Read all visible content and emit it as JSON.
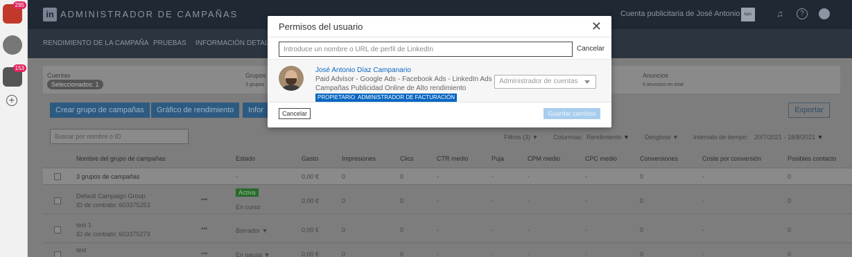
{
  "rail": {
    "apps": [
      {
        "name": "app-1",
        "badge": "295"
      },
      {
        "name": "app-2",
        "badge": ""
      },
      {
        "name": "app-3",
        "badge": "153"
      }
    ],
    "add_icon": "plus-icon"
  },
  "header": {
    "logo": "in",
    "title": "ADMINISTRADOR DE CAMPAÑAS",
    "account": "Cuenta publicitaria de José Antonio",
    "account_logo": "kpis",
    "icons": [
      "bell-icon",
      "help-icon",
      "globe-icon"
    ]
  },
  "subnav": {
    "items": [
      "RENDIMIENTO DE LA CAMPAÑA",
      "PRUEBAS",
      "INFORMACIÓN DETALLA"
    ]
  },
  "cards": {
    "accounts_title": "Cuentas",
    "accounts_chip": "Seleccionados: 1",
    "groups_title": "Grupos",
    "groups_sub": "3 grupos",
    "ads_title": "Anuncios",
    "ads_sub": "0 anuncios en total"
  },
  "actions": {
    "create": "Crear grupo de campañas",
    "chart": "Gráfico de rendimiento",
    "info": "Infor",
    "export": "Exportar"
  },
  "table_search": {
    "placeholder": "Buscar por nombre o ID"
  },
  "filters": {
    "filters": "Filtros (3)",
    "columns": "Columnas:",
    "columns_value": "Rendimiento",
    "breakdown": "Desglose",
    "time_label": "Intervalo de tiempo:",
    "time_value": "20/7/2021 - 18/8/2021"
  },
  "table": {
    "columns": [
      "Nombre del grupo de campañas",
      "Estado",
      "Gasto",
      "Impresiones",
      "Clics",
      "CTR medio",
      "Puja",
      "CPM medio",
      "CPC medio",
      "Conversiones",
      "Coste por conversión",
      "Posibles contacto"
    ],
    "summary": {
      "name": "3 grupos de campañas",
      "estado": "-",
      "gasto": "0,00 €",
      "impresiones": "0",
      "clics": "0",
      "ctr": "-",
      "puja": "-",
      "cpm": "-",
      "cpc": "-",
      "conv": "0",
      "coste": "-",
      "posibles": "0"
    },
    "rows": [
      {
        "name": "Default Campaign Group",
        "id": "ID de contrato: 603375253",
        "more": "•••",
        "status_badge": "Activa",
        "status": "En curso",
        "gasto": "0,00 €",
        "impresiones": "0",
        "clics": "0",
        "ctr": "-",
        "puja": "-",
        "cpm": "-",
        "cpc": "-",
        "conv": "0",
        "coste": "-",
        "posibles": "0"
      },
      {
        "name": "test 1",
        "id": "ID de contrato: 603375273",
        "more": "•••",
        "status": "Borrador ▼",
        "gasto": "0,00 €",
        "impresiones": "0",
        "clics": "0",
        "ctr": "-",
        "puja": "-",
        "cpm": "-",
        "cpc": "-",
        "conv": "0",
        "coste": "-",
        "posibles": "0"
      },
      {
        "name": "test",
        "more": "•••",
        "status": "En pausa ▼",
        "gasto": "0,00 €",
        "impresiones": "0",
        "clics": "0",
        "ctr": "-",
        "puja": "-",
        "cpm": "-",
        "cpc": "-",
        "conv": "0",
        "coste": "-",
        "posibles": "0"
      }
    ]
  },
  "modal": {
    "title": "Permisos del usuario",
    "close": "✕",
    "search_placeholder": "Introduce un nombre o URL de perfil de LinkedIn",
    "search_cancel": "Cancelar",
    "user": {
      "name": "José Antonio Díaz Campanario",
      "headline_1": "Paid Advisor - Google Ads - Facebook Ads - LinkedIn Ads -",
      "headline_2": "Campañas Publicidad Online de Alto rendimiento",
      "badges": [
        "PROPIETARIO",
        "ADMINISTRADOR DE FACTURACIÓN"
      ],
      "role_placeholder": "Administrador de cuentas"
    },
    "cancel_button": "Cancelar",
    "save_button": "Guardar cambios"
  }
}
